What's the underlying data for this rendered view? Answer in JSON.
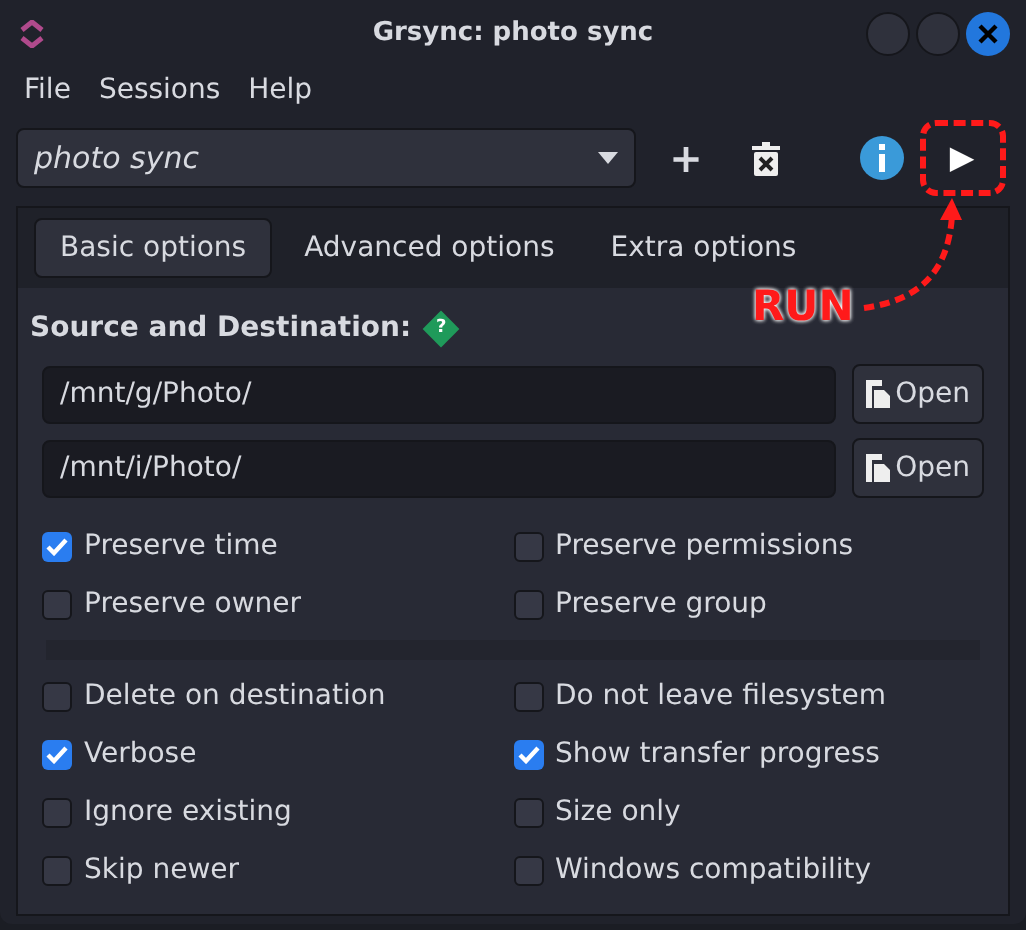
{
  "window": {
    "title": "Grsync: photo sync"
  },
  "menu": [
    "File",
    "Sessions",
    "Help"
  ],
  "session": {
    "value": "photo sync"
  },
  "toolbar": [
    {
      "kind": "add",
      "label": "+"
    },
    {
      "kind": "delete"
    },
    {
      "kind": "info"
    },
    {
      "kind": "run",
      "label": "▶"
    }
  ],
  "annotation": {
    "text": "RUN"
  },
  "tabs": [
    {
      "label": "Basic options",
      "selected": true
    },
    {
      "label": "Advanced options",
      "selected": false
    },
    {
      "label": "Extra options",
      "selected": false
    }
  ],
  "section": {
    "title": "Source and Destination:",
    "help": "?"
  },
  "paths": [
    {
      "value": "/mnt/g/Photo/",
      "button": "Open"
    },
    {
      "value": "/mnt/i/Photo/",
      "button": "Open"
    }
  ],
  "option_groups": [
    [
      {
        "label": "Preserve time",
        "checked": true
      },
      {
        "label": "Preserve permissions",
        "checked": false
      },
      {
        "label": "Preserve owner",
        "checked": false
      },
      {
        "label": "Preserve group",
        "checked": false
      }
    ],
    [
      {
        "label": "Delete on destination",
        "checked": false
      },
      {
        "label": "Do not leave filesystem",
        "checked": false
      },
      {
        "label": "Verbose",
        "checked": true
      },
      {
        "label": "Show transfer progress",
        "checked": true
      },
      {
        "label": "Ignore existing",
        "checked": false
      },
      {
        "label": "Size only",
        "checked": false
      },
      {
        "label": "Skip newer",
        "checked": false
      },
      {
        "label": "Windows compatibility",
        "checked": false
      }
    ]
  ]
}
